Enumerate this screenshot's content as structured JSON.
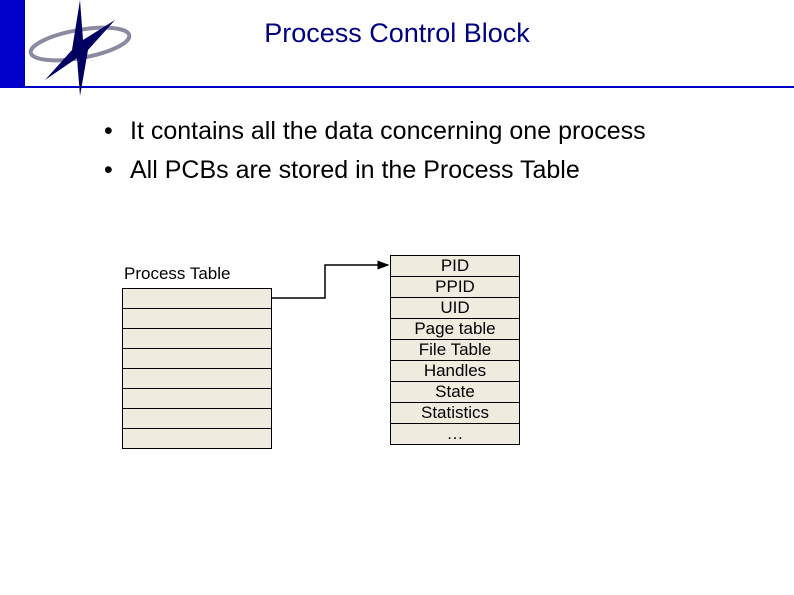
{
  "title": "Process Control Block",
  "bullets": [
    "It contains all the data concerning one process",
    "All PCBs are stored in the Process Table"
  ],
  "diagram": {
    "process_table_label": "Process Table",
    "pcb_fields": [
      "PID",
      "PPID",
      "UID",
      "Page table",
      "File Table",
      "Handles",
      "State",
      "Statistics",
      "…"
    ],
    "process_table_rows": 8
  }
}
